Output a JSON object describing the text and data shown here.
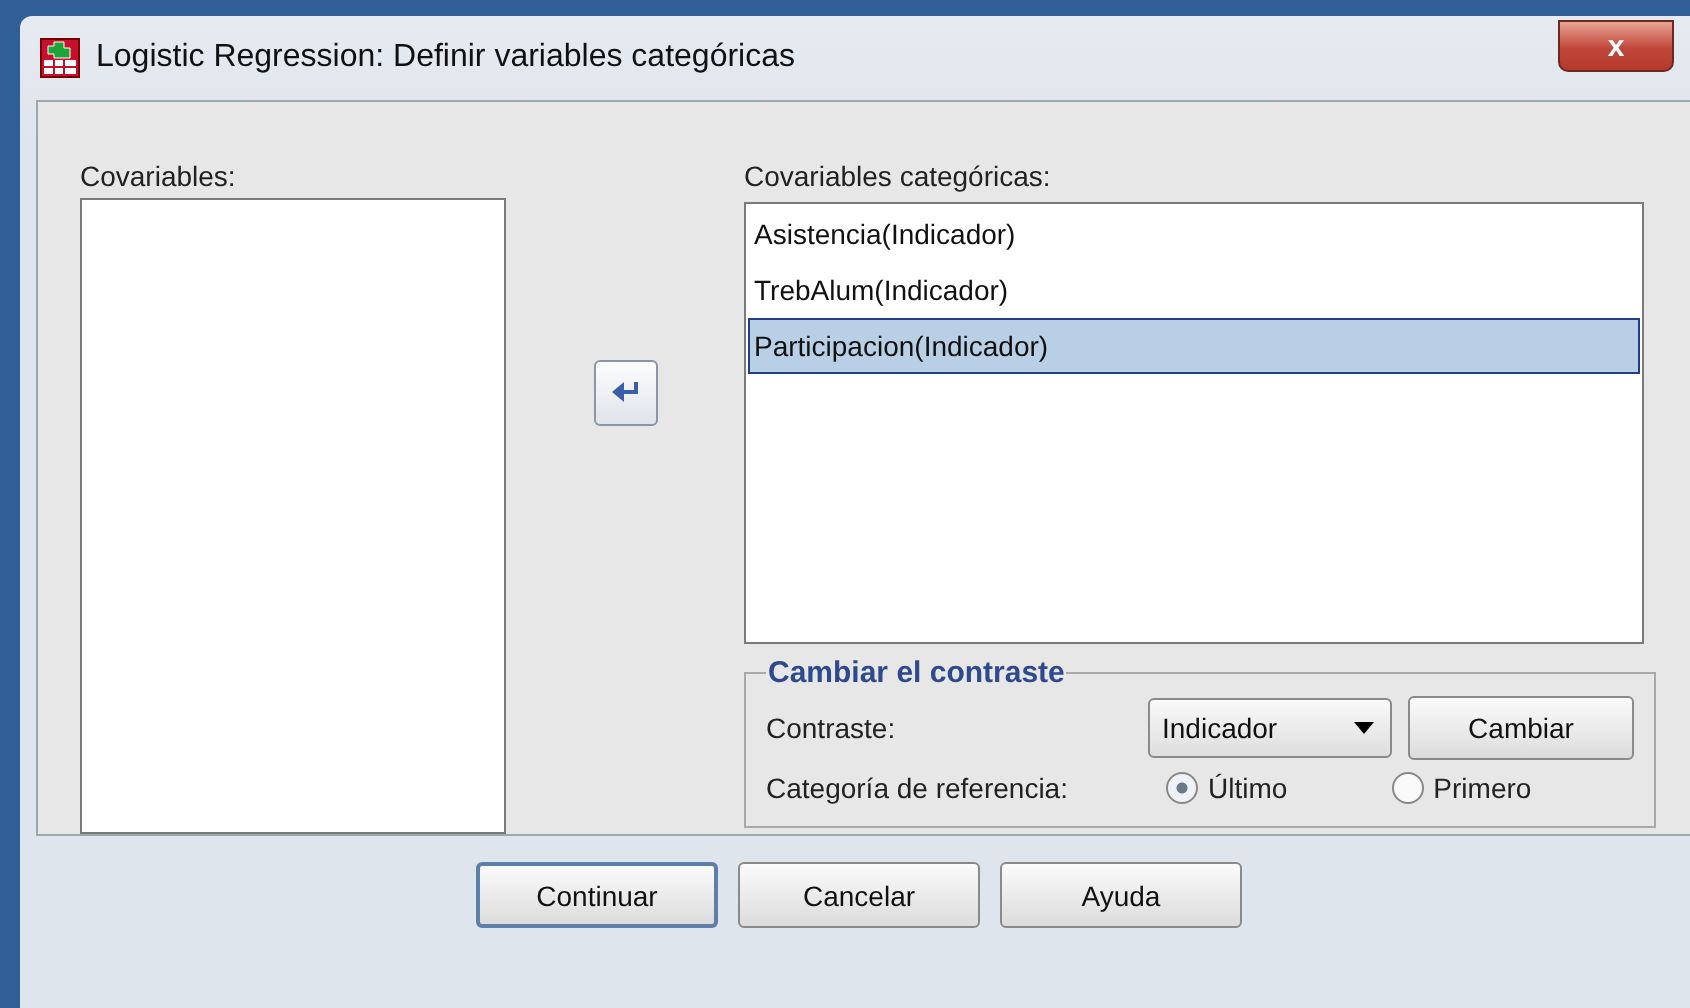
{
  "window": {
    "title": "Logistic Regression: Definir variables categóricas",
    "close": "x"
  },
  "covariables": {
    "label": "Covariables:"
  },
  "move_button": {
    "kind": "arrow-left"
  },
  "categorical": {
    "label": "Covariables categóricas:",
    "items": [
      {
        "text": "Asistencia(Indicador)",
        "selected": false
      },
      {
        "text": "TrebAlum(Indicador)",
        "selected": false
      },
      {
        "text": "Participacion(Indicador)",
        "selected": true
      }
    ]
  },
  "contrast_group": {
    "title": "Cambiar el contraste",
    "contrast_label": "Contraste:",
    "contrast_value": "Indicador",
    "change_button": "Cambiar",
    "reference_label": "Categoría de referencia:",
    "options": [
      {
        "label": "Último",
        "selected": true
      },
      {
        "label": "Primero",
        "selected": false
      }
    ]
  },
  "buttons": [
    {
      "label": "Continuar",
      "default": true
    },
    {
      "label": "Cancelar",
      "default": false
    },
    {
      "label": "Ayuda",
      "default": false
    }
  ]
}
